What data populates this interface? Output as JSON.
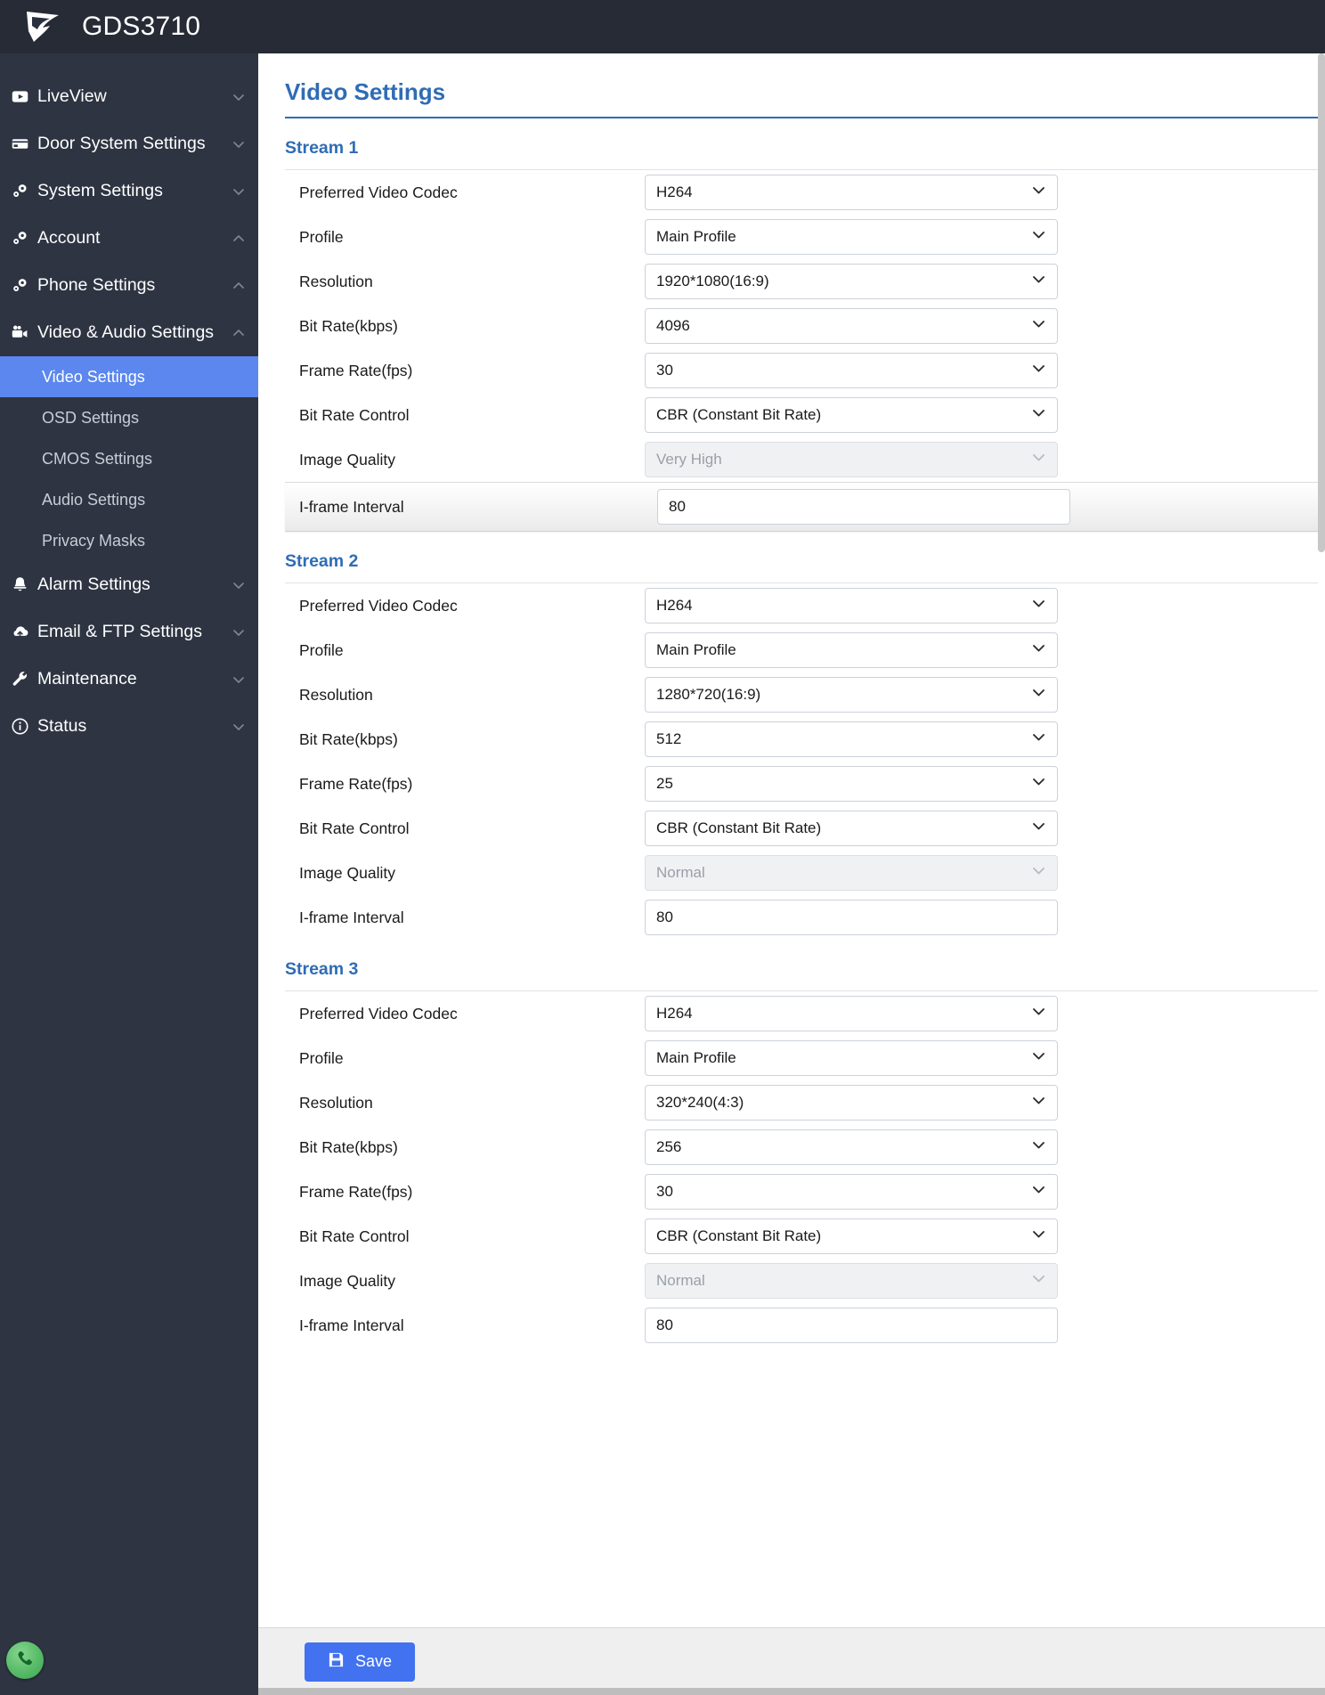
{
  "header": {
    "brand": "GDS3710",
    "logo_icon": "grandstream-logo-icon"
  },
  "sidebar": {
    "items": [
      {
        "label": "LiveView",
        "icon": "video-play-icon",
        "caret": "chevron-down-icon",
        "active": false
      },
      {
        "label": "Door System Settings",
        "icon": "card-reader-icon",
        "caret": "chevron-down-icon",
        "active": false
      },
      {
        "label": "System Settings",
        "icon": "gears-icon",
        "caret": "chevron-down-icon",
        "active": false
      },
      {
        "label": "Account",
        "icon": "gears-icon",
        "caret": "chevron-up-icon",
        "active": false
      },
      {
        "label": "Phone Settings",
        "icon": "gears-icon",
        "caret": "chevron-up-icon",
        "active": false
      },
      {
        "label": "Video & Audio Settings",
        "icon": "video-camera-icon",
        "caret": "chevron-up-icon",
        "active": false
      }
    ],
    "sub_items": [
      {
        "label": "Video Settings",
        "active": true
      },
      {
        "label": "OSD Settings",
        "active": false
      },
      {
        "label": "CMOS Settings",
        "active": false
      },
      {
        "label": "Audio Settings",
        "active": false
      },
      {
        "label": "Privacy Masks",
        "active": false
      }
    ],
    "items_after": [
      {
        "label": "Alarm Settings",
        "icon": "bell-icon",
        "caret": "chevron-down-icon",
        "active": false
      },
      {
        "label": "Email & FTP Settings",
        "icon": "cloud-upload-icon",
        "caret": "chevron-down-icon",
        "active": false
      },
      {
        "label": "Maintenance",
        "icon": "wrench-icon",
        "caret": "chevron-down-icon",
        "active": false
      },
      {
        "label": "Status",
        "icon": "info-circle-icon",
        "caret": "chevron-down-icon",
        "active": false
      }
    ],
    "call_button": {
      "icon": "phone-icon",
      "accent": "#4fb962"
    }
  },
  "main": {
    "page_title": "Video Settings",
    "accent_color": "#2f6cb5",
    "sections": [
      {
        "title": "Stream 1",
        "fields": [
          {
            "label": "Preferred Video Codec",
            "value": "H264",
            "type": "select",
            "disabled": false,
            "highlight": false
          },
          {
            "label": "Profile",
            "value": "Main Profile",
            "type": "select",
            "disabled": false,
            "highlight": false
          },
          {
            "label": "Resolution",
            "value": "1920*1080(16:9)",
            "type": "select",
            "disabled": false,
            "highlight": false
          },
          {
            "label": "Bit Rate(kbps)",
            "value": "4096",
            "type": "select",
            "disabled": false,
            "highlight": false
          },
          {
            "label": "Frame Rate(fps)",
            "value": "30",
            "type": "select",
            "disabled": false,
            "highlight": false
          },
          {
            "label": "Bit Rate Control",
            "value": "CBR (Constant Bit Rate)",
            "type": "select",
            "disabled": false,
            "highlight": false
          },
          {
            "label": "Image Quality",
            "value": "Very High",
            "type": "select",
            "disabled": true,
            "highlight": false
          },
          {
            "label": "I-frame Interval",
            "value": "80",
            "type": "text",
            "disabled": false,
            "highlight": true
          }
        ]
      },
      {
        "title": "Stream 2",
        "fields": [
          {
            "label": "Preferred Video Codec",
            "value": "H264",
            "type": "select",
            "disabled": false,
            "highlight": false
          },
          {
            "label": "Profile",
            "value": "Main Profile",
            "type": "select",
            "disabled": false,
            "highlight": false
          },
          {
            "label": "Resolution",
            "value": "1280*720(16:9)",
            "type": "select",
            "disabled": false,
            "highlight": false
          },
          {
            "label": "Bit Rate(kbps)",
            "value": "512",
            "type": "select",
            "disabled": false,
            "highlight": false
          },
          {
            "label": "Frame Rate(fps)",
            "value": "25",
            "type": "select",
            "disabled": false,
            "highlight": false
          },
          {
            "label": "Bit Rate Control",
            "value": "CBR (Constant Bit Rate)",
            "type": "select",
            "disabled": false,
            "highlight": false
          },
          {
            "label": "Image Quality",
            "value": "Normal",
            "type": "select",
            "disabled": true,
            "highlight": false
          },
          {
            "label": "I-frame Interval",
            "value": "80",
            "type": "text",
            "disabled": false,
            "highlight": false
          }
        ]
      },
      {
        "title": "Stream 3",
        "fields": [
          {
            "label": "Preferred Video Codec",
            "value": "H264",
            "type": "select",
            "disabled": false,
            "highlight": false
          },
          {
            "label": "Profile",
            "value": "Main Profile",
            "type": "select",
            "disabled": false,
            "highlight": false
          },
          {
            "label": "Resolution",
            "value": "320*240(4:3)",
            "type": "select",
            "disabled": false,
            "highlight": false
          },
          {
            "label": "Bit Rate(kbps)",
            "value": "256",
            "type": "select",
            "disabled": false,
            "highlight": false
          },
          {
            "label": "Frame Rate(fps)",
            "value": "30",
            "type": "select",
            "disabled": false,
            "highlight": false
          },
          {
            "label": "Bit Rate Control",
            "value": "CBR (Constant Bit Rate)",
            "type": "select",
            "disabled": false,
            "highlight": false
          },
          {
            "label": "Image Quality",
            "value": "Normal",
            "type": "select",
            "disabled": true,
            "highlight": false
          },
          {
            "label": "I-frame Interval",
            "value": "80",
            "type": "text",
            "disabled": false,
            "highlight": false
          }
        ]
      }
    ]
  },
  "footer": {
    "save_label": "Save",
    "save_icon": "floppy-save-icon",
    "save_color": "#4272ef"
  }
}
